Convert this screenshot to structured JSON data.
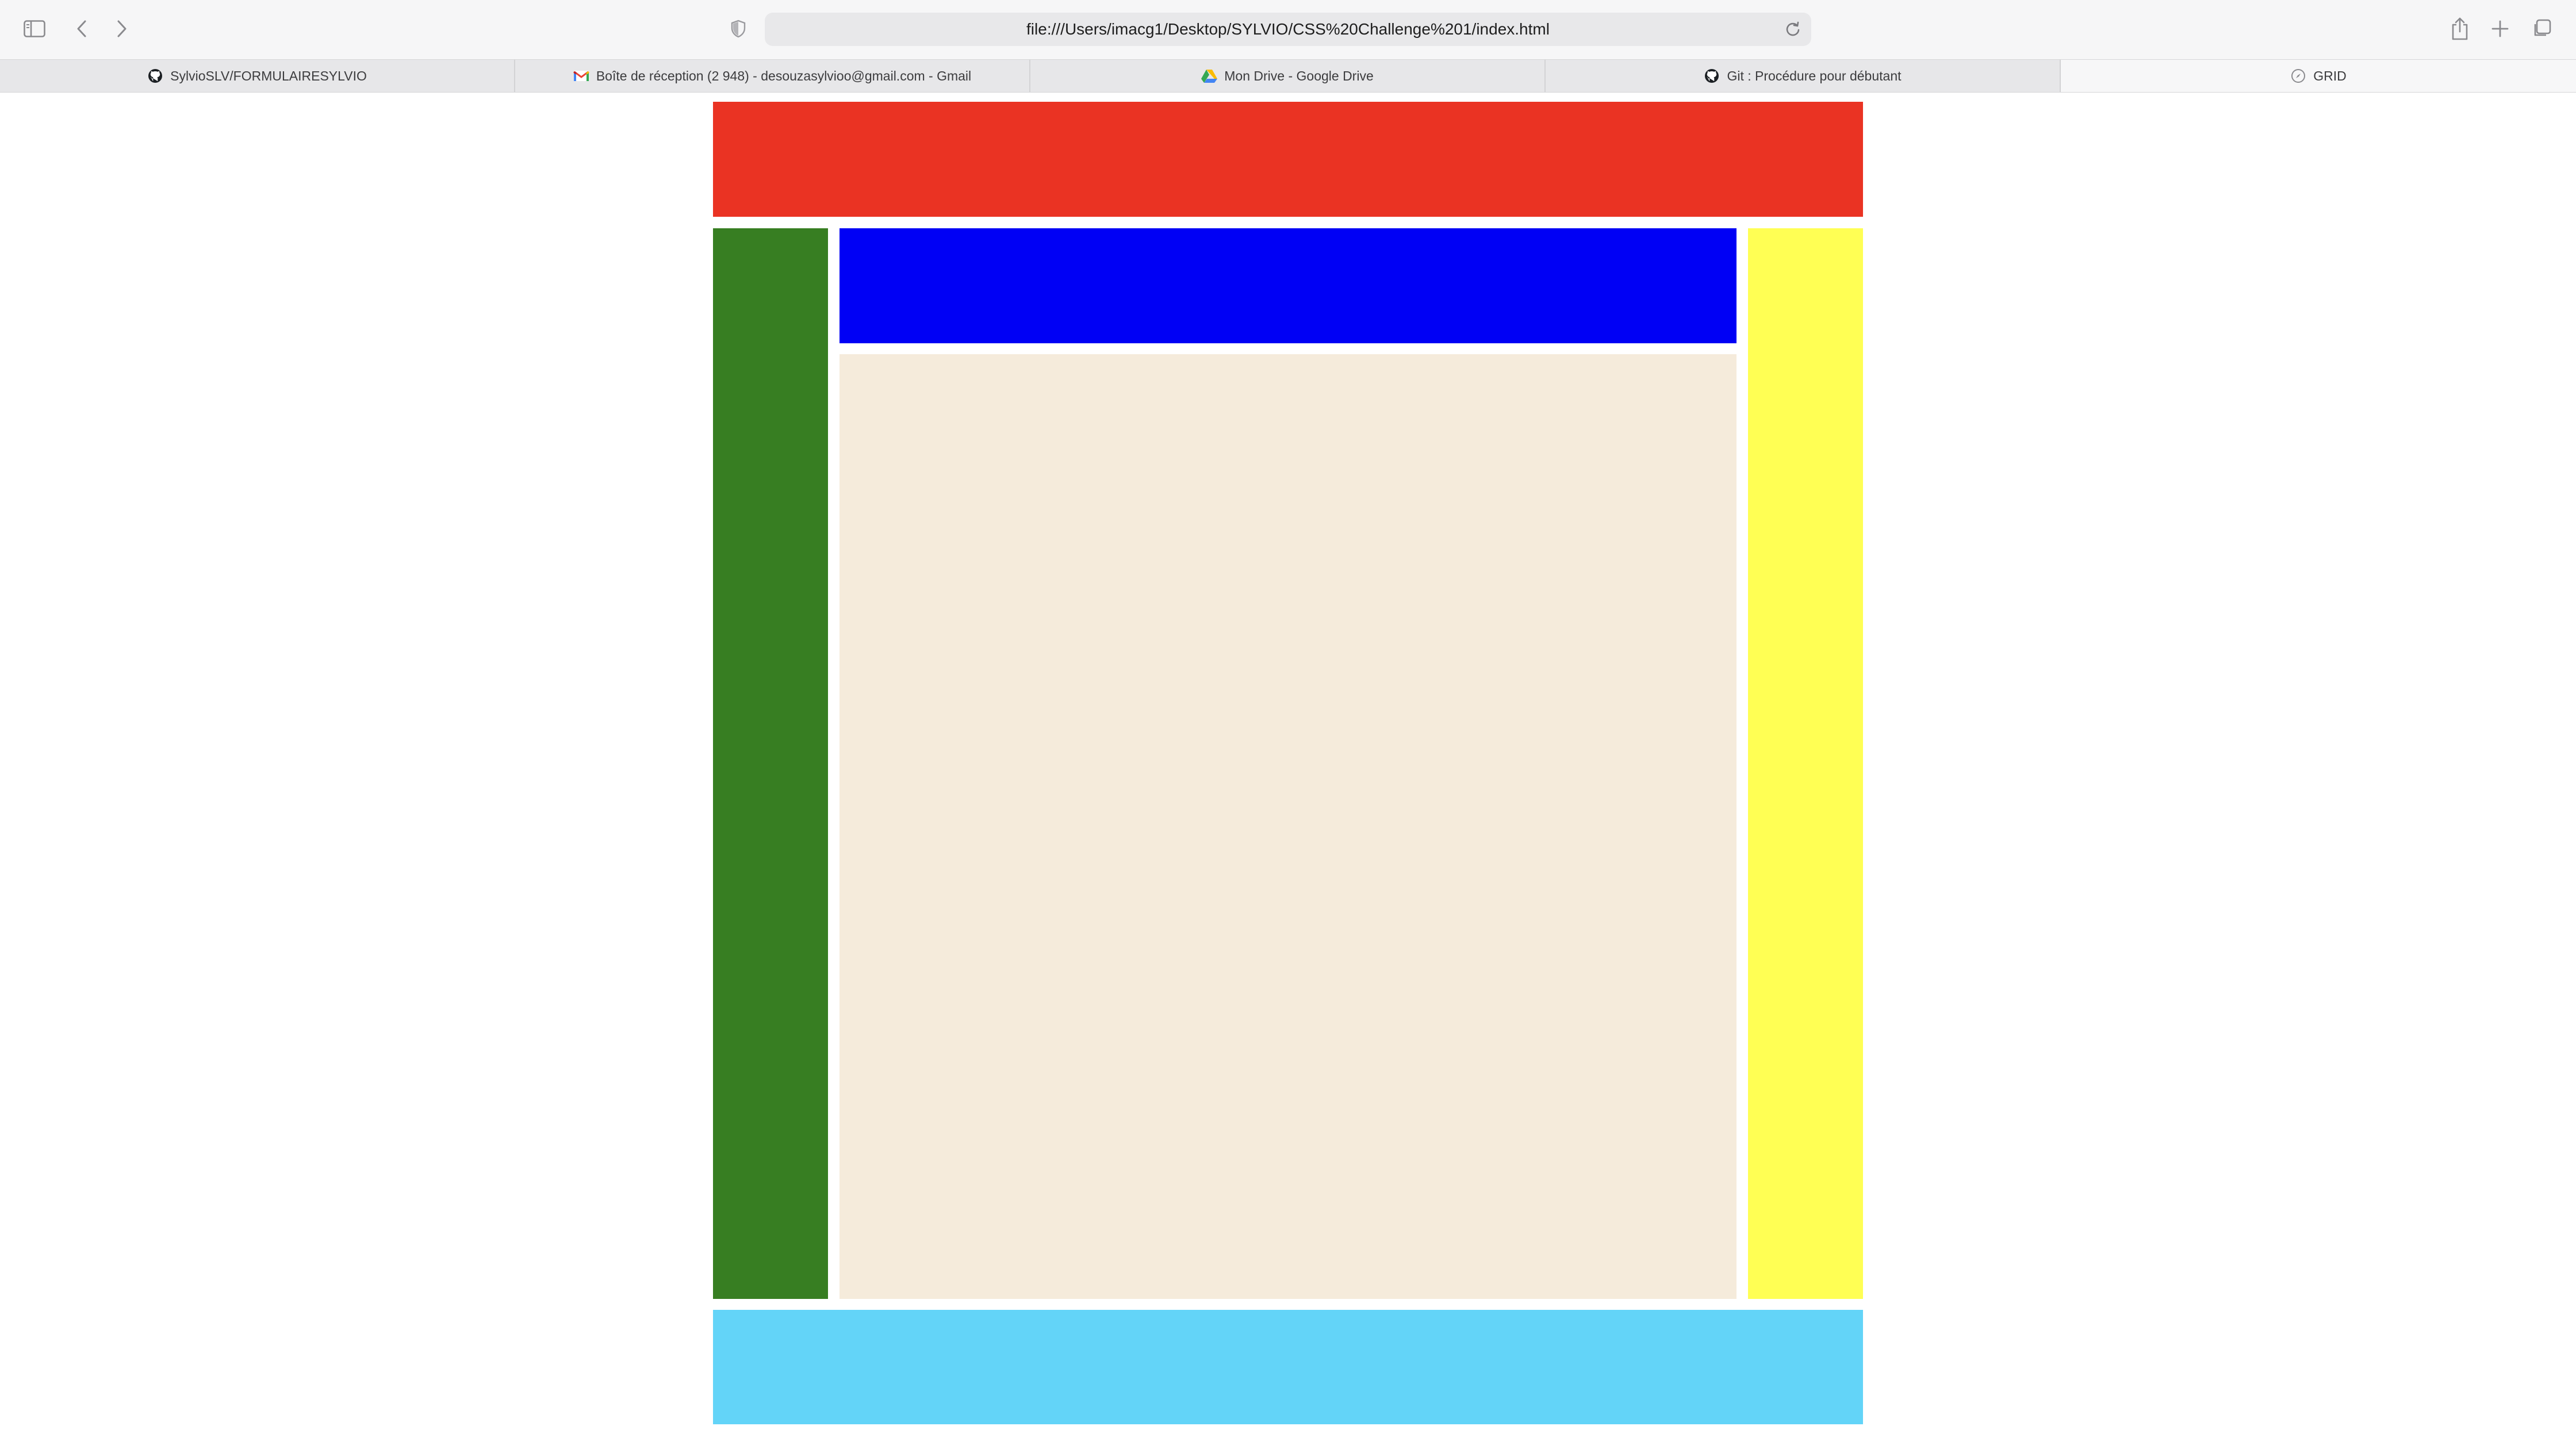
{
  "browser": {
    "url": "file:///Users/imacg1/Desktop/SYLVIO/CSS%20Challenge%201/index.html",
    "tabs": [
      {
        "label": "SylvioSLV/FORMULAIRESYLVIO",
        "icon": "github-icon"
      },
      {
        "label": "Boîte de réception (2 948) - desouzasylvioo@gmail.com - Gmail",
        "icon": "gmail-icon"
      },
      {
        "label": "Mon Drive - Google Drive",
        "icon": "google-drive-icon"
      },
      {
        "label": "Git : Procédure pour débutant",
        "icon": "github-icon"
      },
      {
        "label": "GRID",
        "icon": "compass-icon",
        "active": true
      }
    ]
  },
  "layout_colors": {
    "header": "#ea3323",
    "left_column": "#377e22",
    "top_band": "#0000f5",
    "main": "#f5ebdb",
    "right_column": "#ffff54",
    "footer": "#63d4f8"
  }
}
